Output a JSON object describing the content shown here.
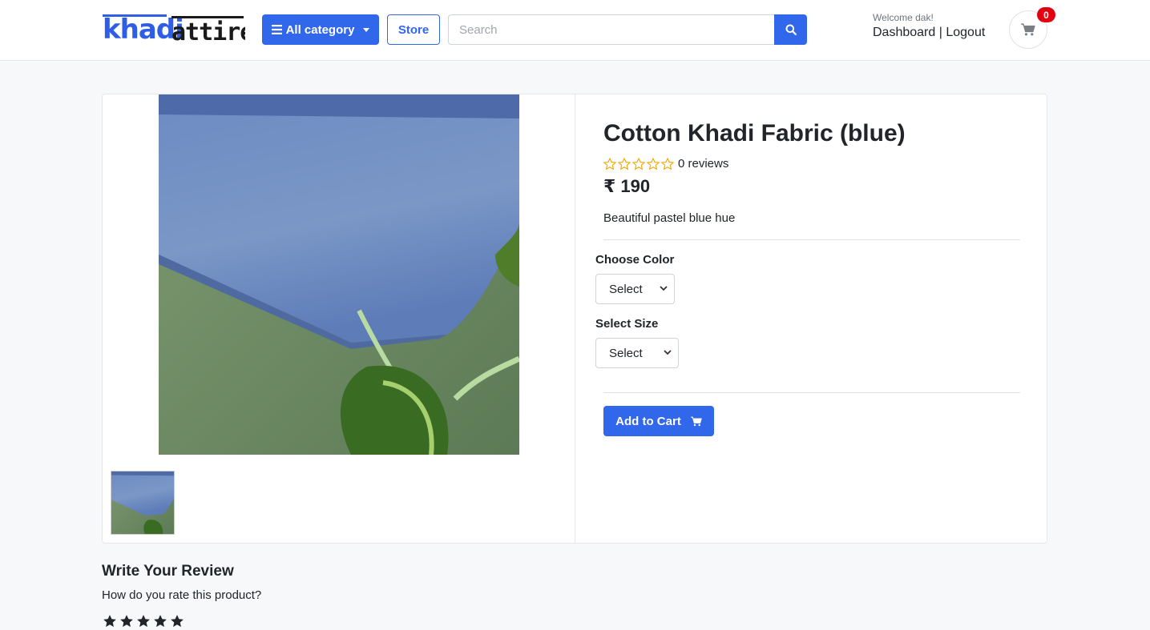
{
  "header": {
    "logo_text_a": "khadi",
    "logo_text_b": "attire",
    "category_label": "All category",
    "store_label": "Store",
    "search_placeholder": "Search",
    "welcome_text": "Welcome dak!",
    "dashboard_label": "Dashboard",
    "separator": "|",
    "logout_label": "Logout",
    "cart_count": "0"
  },
  "product": {
    "title": "Cotton Khadi Fabric (blue)",
    "rating_stars": 0,
    "reviews_text": "0 reviews",
    "price": "₹ 190",
    "description": "Beautiful pastel blue hue",
    "color_label": "Choose Color",
    "color_select_value": "Select",
    "size_label": "Select Size",
    "size_select_value": "Select",
    "add_to_cart_label": "Add to Cart"
  },
  "review": {
    "heading": "Write Your Review",
    "question": "How do you rate this product?"
  },
  "colors": {
    "primary": "#3167eb",
    "badge": "#e3000f",
    "star_outline": "#f0a500",
    "text": "#212529"
  },
  "icons": {
    "category": "bars-icon",
    "search": "search-icon",
    "cart": "cart-icon",
    "star": "star-icon"
  }
}
